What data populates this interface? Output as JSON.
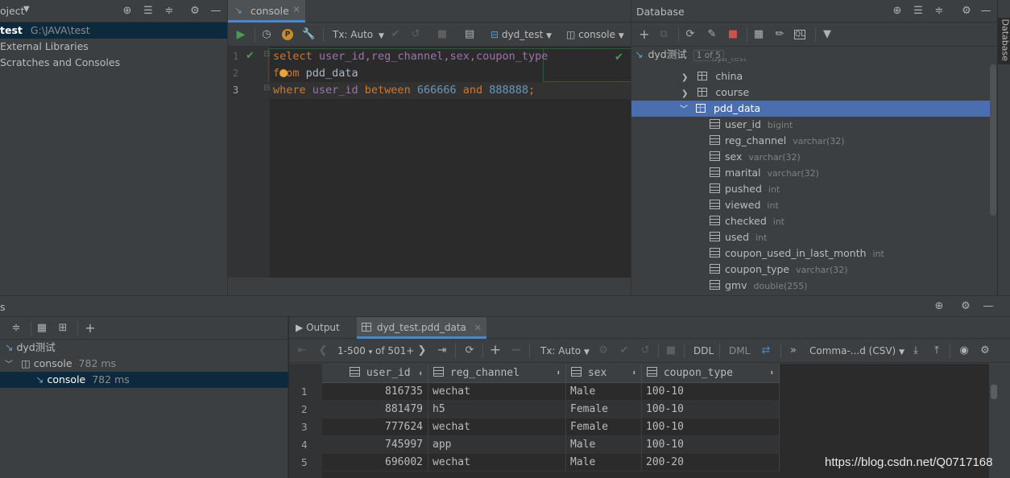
{
  "project": {
    "title": "oject",
    "root_name": "test",
    "root_path": "G:\\JAVA\\test",
    "items": [
      "External Libraries",
      "Scratches and Consoles"
    ]
  },
  "editor": {
    "tab_label": "console",
    "toolbar": {
      "tx": "Tx: Auto",
      "schema": "dyd_test",
      "session": "console"
    },
    "line_numbers": [
      "1",
      "2",
      "3"
    ],
    "lines": [
      [
        "select",
        " user_id,reg_channel,sex,coupon_type"
      ],
      [
        "from",
        " pdd_data"
      ],
      [
        "where",
        " user_id ",
        "between",
        " ",
        "666666",
        " ",
        "and",
        " ",
        "888888",
        ";"
      ]
    ]
  },
  "database": {
    "title": "Database",
    "vertical_tab": "Database",
    "root_label": "dyd测试",
    "root_badge": "1 of 5",
    "schema_hint": "dyd_test",
    "tables": [
      "china",
      "course",
      "pdd_data"
    ],
    "columns": [
      {
        "name": "user_id",
        "type": "bigint"
      },
      {
        "name": "reg_channel",
        "type": "varchar(32)"
      },
      {
        "name": "sex",
        "type": "varchar(32)"
      },
      {
        "name": "marital",
        "type": "varchar(32)"
      },
      {
        "name": "pushed",
        "type": "int"
      },
      {
        "name": "viewed",
        "type": "int"
      },
      {
        "name": "checked",
        "type": "int"
      },
      {
        "name": "used",
        "type": "int"
      },
      {
        "name": "coupon_used_in_last_month",
        "type": "int"
      },
      {
        "name": "coupon_type",
        "type": "varchar(32)"
      },
      {
        "name": "gmv",
        "type": "double(255)"
      }
    ]
  },
  "services": {
    "title": "s",
    "tree": [
      {
        "label": "dyd测试",
        "time": ""
      },
      {
        "label": "console",
        "time": "782 ms"
      },
      {
        "label": "console",
        "time": "782 ms"
      }
    ]
  },
  "results": {
    "tabs": [
      "Output",
      "dyd_test.pdd_data"
    ],
    "toolbar": {
      "range": "1-500",
      "of": "of 501+",
      "tx": "Tx: Auto",
      "ddl": "DDL",
      "dml": "DML",
      "export": "Comma-...d (CSV)"
    },
    "headers": [
      "user_id",
      "reg_channel",
      "sex",
      "coupon_type"
    ],
    "row_numbers": [
      "1",
      "2",
      "3",
      "4",
      "5"
    ],
    "rows": [
      [
        "816735",
        "wechat",
        "Male",
        "100-10"
      ],
      [
        "881479",
        "h5",
        "Female",
        "100-10"
      ],
      [
        "777624",
        "wechat",
        "Female",
        "100-10"
      ],
      [
        "745997",
        "app",
        "Male",
        "100-10"
      ],
      [
        "696002",
        "wechat",
        "Male",
        "200-20"
      ]
    ]
  },
  "watermark": "https://blog.csdn.net/Q0717168"
}
